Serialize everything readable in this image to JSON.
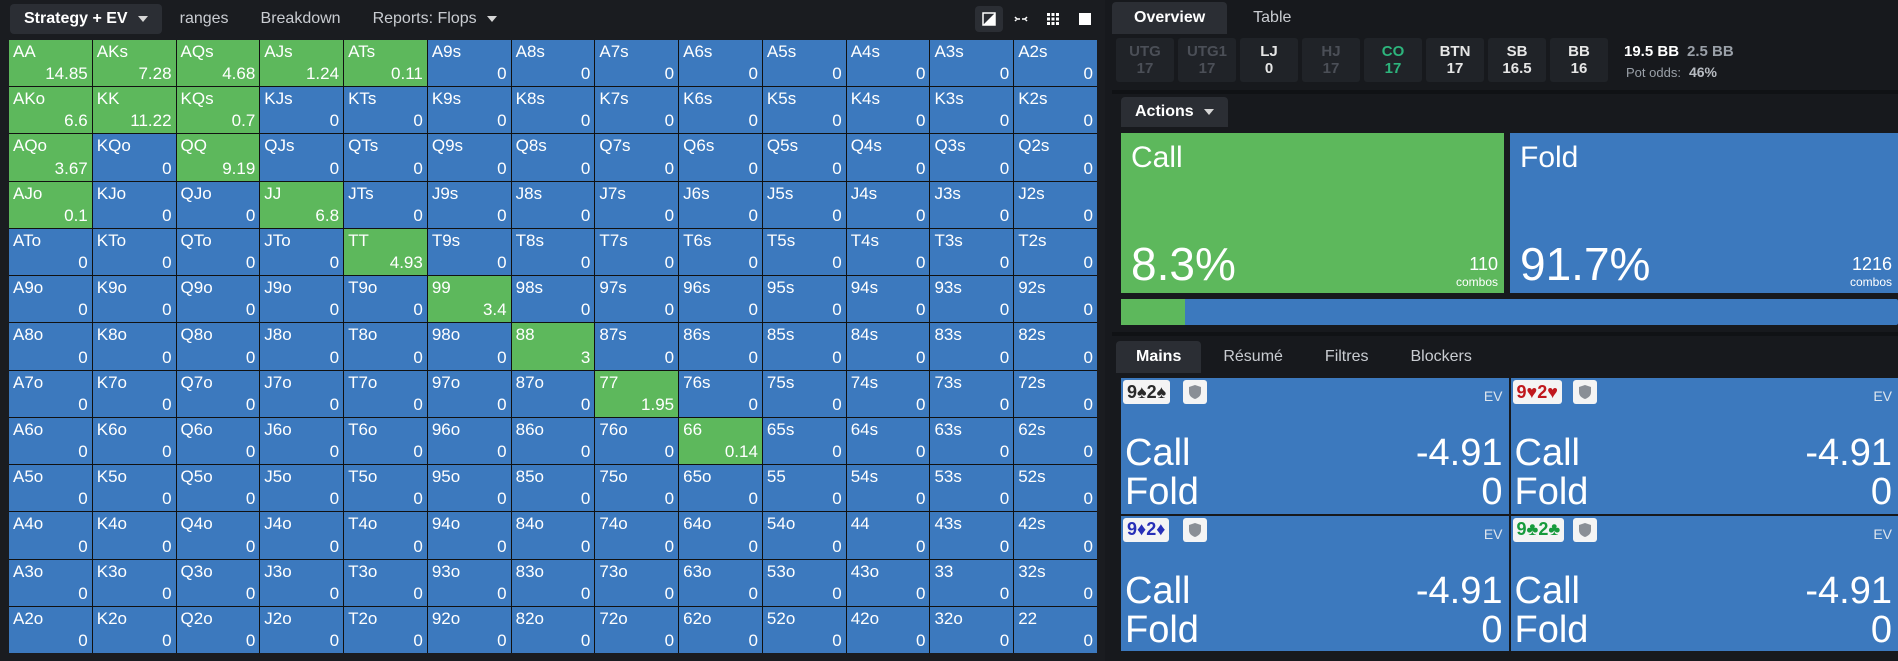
{
  "top_tabs": [
    {
      "label": "Strategy + EV",
      "dropdown": true,
      "active": true
    },
    {
      "label": "ranges",
      "dropdown": false,
      "active": false
    },
    {
      "label": "Breakdown",
      "dropdown": false,
      "active": false
    },
    {
      "label": "Reports: Flops",
      "dropdown": true,
      "active": false
    }
  ],
  "grid": {
    "hands": [
      [
        "AA",
        "AKs",
        "AQs",
        "AJs",
        "ATs",
        "A9s",
        "A8s",
        "A7s",
        "A6s",
        "A5s",
        "A4s",
        "A3s",
        "A2s"
      ],
      [
        "AKo",
        "KK",
        "KQs",
        "KJs",
        "KTs",
        "K9s",
        "K8s",
        "K7s",
        "K6s",
        "K5s",
        "K4s",
        "K3s",
        "K2s"
      ],
      [
        "AQo",
        "KQo",
        "QQ",
        "QJs",
        "QTs",
        "Q9s",
        "Q8s",
        "Q7s",
        "Q6s",
        "Q5s",
        "Q4s",
        "Q3s",
        "Q2s"
      ],
      [
        "AJo",
        "KJo",
        "QJo",
        "JJ",
        "JTs",
        "J9s",
        "J8s",
        "J7s",
        "J6s",
        "J5s",
        "J4s",
        "J3s",
        "J2s"
      ],
      [
        "ATo",
        "KTo",
        "QTo",
        "JTo",
        "TT",
        "T9s",
        "T8s",
        "T7s",
        "T6s",
        "T5s",
        "T4s",
        "T3s",
        "T2s"
      ],
      [
        "A9o",
        "K9o",
        "Q9o",
        "J9o",
        "T9o",
        "99",
        "98s",
        "97s",
        "96s",
        "95s",
        "94s",
        "93s",
        "92s"
      ],
      [
        "A8o",
        "K8o",
        "Q8o",
        "J8o",
        "T8o",
        "98o",
        "88",
        "87s",
        "86s",
        "85s",
        "84s",
        "83s",
        "82s"
      ],
      [
        "A7o",
        "K7o",
        "Q7o",
        "J7o",
        "T7o",
        "97o",
        "87o",
        "77",
        "76s",
        "75s",
        "74s",
        "73s",
        "72s"
      ],
      [
        "A6o",
        "K6o",
        "Q6o",
        "J6o",
        "T6o",
        "96o",
        "86o",
        "76o",
        "66",
        "65s",
        "64s",
        "63s",
        "62s"
      ],
      [
        "A5o",
        "K5o",
        "Q5o",
        "J5o",
        "T5o",
        "95o",
        "85o",
        "75o",
        "65o",
        "55",
        "54s",
        "53s",
        "52s"
      ],
      [
        "A4o",
        "K4o",
        "Q4o",
        "J4o",
        "T4o",
        "94o",
        "84o",
        "74o",
        "64o",
        "54o",
        "44",
        "43s",
        "42s"
      ],
      [
        "A3o",
        "K3o",
        "Q3o",
        "J3o",
        "T3o",
        "93o",
        "83o",
        "73o",
        "63o",
        "53o",
        "43o",
        "33",
        "32s"
      ],
      [
        "A2o",
        "K2o",
        "Q2o",
        "J2o",
        "T2o",
        "92o",
        "82o",
        "72o",
        "62o",
        "52o",
        "42o",
        "32o",
        "22"
      ]
    ],
    "values": [
      [
        "14.85",
        "7.28",
        "4.68",
        "1.24",
        "0.11",
        "0",
        "0",
        "0",
        "0",
        "0",
        "0",
        "0",
        "0"
      ],
      [
        "6.6",
        "11.22",
        "0.7",
        "0",
        "0",
        "0",
        "0",
        "0",
        "0",
        "0",
        "0",
        "0",
        "0"
      ],
      [
        "3.67",
        "0",
        "9.19",
        "0",
        "0",
        "0",
        "0",
        "0",
        "0",
        "0",
        "0",
        "0",
        "0"
      ],
      [
        "0.1",
        "0",
        "0",
        "6.8",
        "0",
        "0",
        "0",
        "0",
        "0",
        "0",
        "0",
        "0",
        "0"
      ],
      [
        "0",
        "0",
        "0",
        "0",
        "4.93",
        "0",
        "0",
        "0",
        "0",
        "0",
        "0",
        "0",
        "0"
      ],
      [
        "0",
        "0",
        "0",
        "0",
        "0",
        "3.4",
        "0",
        "0",
        "0",
        "0",
        "0",
        "0",
        "0"
      ],
      [
        "0",
        "0",
        "0",
        "0",
        "0",
        "0",
        "3",
        "0",
        "0",
        "0",
        "0",
        "0",
        "0"
      ],
      [
        "0",
        "0",
        "0",
        "0",
        "0",
        "0",
        "0",
        "1.95",
        "0",
        "0",
        "0",
        "0",
        "0"
      ],
      [
        "0",
        "0",
        "0",
        "0",
        "0",
        "0",
        "0",
        "0",
        "0.14",
        "0",
        "0",
        "0",
        "0"
      ],
      [
        "0",
        "0",
        "0",
        "0",
        "0",
        "0",
        "0",
        "0",
        "0",
        "0",
        "0",
        "0",
        "0"
      ],
      [
        "0",
        "0",
        "0",
        "0",
        "0",
        "0",
        "0",
        "0",
        "0",
        "0",
        "0",
        "0",
        "0"
      ],
      [
        "0",
        "0",
        "0",
        "0",
        "0",
        "0",
        "0",
        "0",
        "0",
        "0",
        "0",
        "0",
        "0"
      ],
      [
        "0",
        "0",
        "0",
        "0",
        "0",
        "0",
        "0",
        "0",
        "0",
        "0",
        "0",
        "0",
        "0"
      ]
    ],
    "call_hands": [
      "AA",
      "AKs",
      "AQs",
      "AJs",
      "ATs",
      "AKo",
      "KK",
      "KQs",
      "AQo",
      "QQ",
      "AJo",
      "JJ",
      "TT",
      "99",
      "88",
      "77",
      "66"
    ],
    "call_color": "#5db85c",
    "fold_color": "#3c79be"
  },
  "right_tabs": [
    {
      "label": "Overview",
      "active": true
    },
    {
      "label": "Table",
      "active": false
    }
  ],
  "positions": [
    {
      "name": "UTG",
      "stack": "17",
      "state": "dim"
    },
    {
      "name": "UTG1",
      "stack": "17",
      "state": "dim"
    },
    {
      "name": "LJ",
      "stack": "0",
      "state": "normal"
    },
    {
      "name": "HJ",
      "stack": "17",
      "state": "dim"
    },
    {
      "name": "CO",
      "stack": "17",
      "state": "active"
    },
    {
      "name": "BTN",
      "stack": "17",
      "state": "normal"
    },
    {
      "name": "SB",
      "stack": "16.5",
      "state": "normal"
    },
    {
      "name": "BB",
      "stack": "16",
      "state": "normal"
    }
  ],
  "pot": {
    "total": "19.5 BB",
    "to_call": "2.5 BB",
    "odds_label": "Pot odds:",
    "odds_value": "46%"
  },
  "actions_label": "Actions",
  "actions": [
    {
      "name": "Call",
      "pct": "8.3%",
      "combos": "110",
      "combos_label": "combos",
      "color": "#5db85c",
      "fraction": 0.083
    },
    {
      "name": "Fold",
      "pct": "91.7%",
      "combos": "1216",
      "combos_label": "combos",
      "color": "#3c79be",
      "fraction": 0.917
    }
  ],
  "bottom_tabs": [
    {
      "label": "Mains",
      "active": true
    },
    {
      "label": "Résumé",
      "active": false
    },
    {
      "label": "Filtres",
      "active": false
    },
    {
      "label": "Blockers",
      "active": false
    }
  ],
  "hand_cards": [
    {
      "rank1": "9",
      "suit1": "♠",
      "rank2": "2",
      "suit2": "♠",
      "suit_class": "spade",
      "ev_label": "EV",
      "rows": [
        {
          "action": "Call",
          "ev": "-4.91"
        },
        {
          "action": "Fold",
          "ev": "0"
        }
      ]
    },
    {
      "rank1": "9",
      "suit1": "♥",
      "rank2": "2",
      "suit2": "♥",
      "suit_class": "heart",
      "ev_label": "EV",
      "rows": [
        {
          "action": "Call",
          "ev": "-4.91"
        },
        {
          "action": "Fold",
          "ev": "0"
        }
      ]
    },
    {
      "rank1": "9",
      "suit1": "♦",
      "rank2": "2",
      "suit2": "♦",
      "suit_class": "diam",
      "ev_label": "EV",
      "rows": [
        {
          "action": "Call",
          "ev": "-4.91"
        },
        {
          "action": "Fold",
          "ev": "0"
        }
      ]
    },
    {
      "rank1": "9",
      "suit1": "♣",
      "rank2": "2",
      "suit2": "♣",
      "suit_class": "clubg",
      "ev_label": "EV",
      "rows": [
        {
          "action": "Call",
          "ev": "-4.91"
        },
        {
          "action": "Fold",
          "ev": "0"
        }
      ]
    }
  ]
}
